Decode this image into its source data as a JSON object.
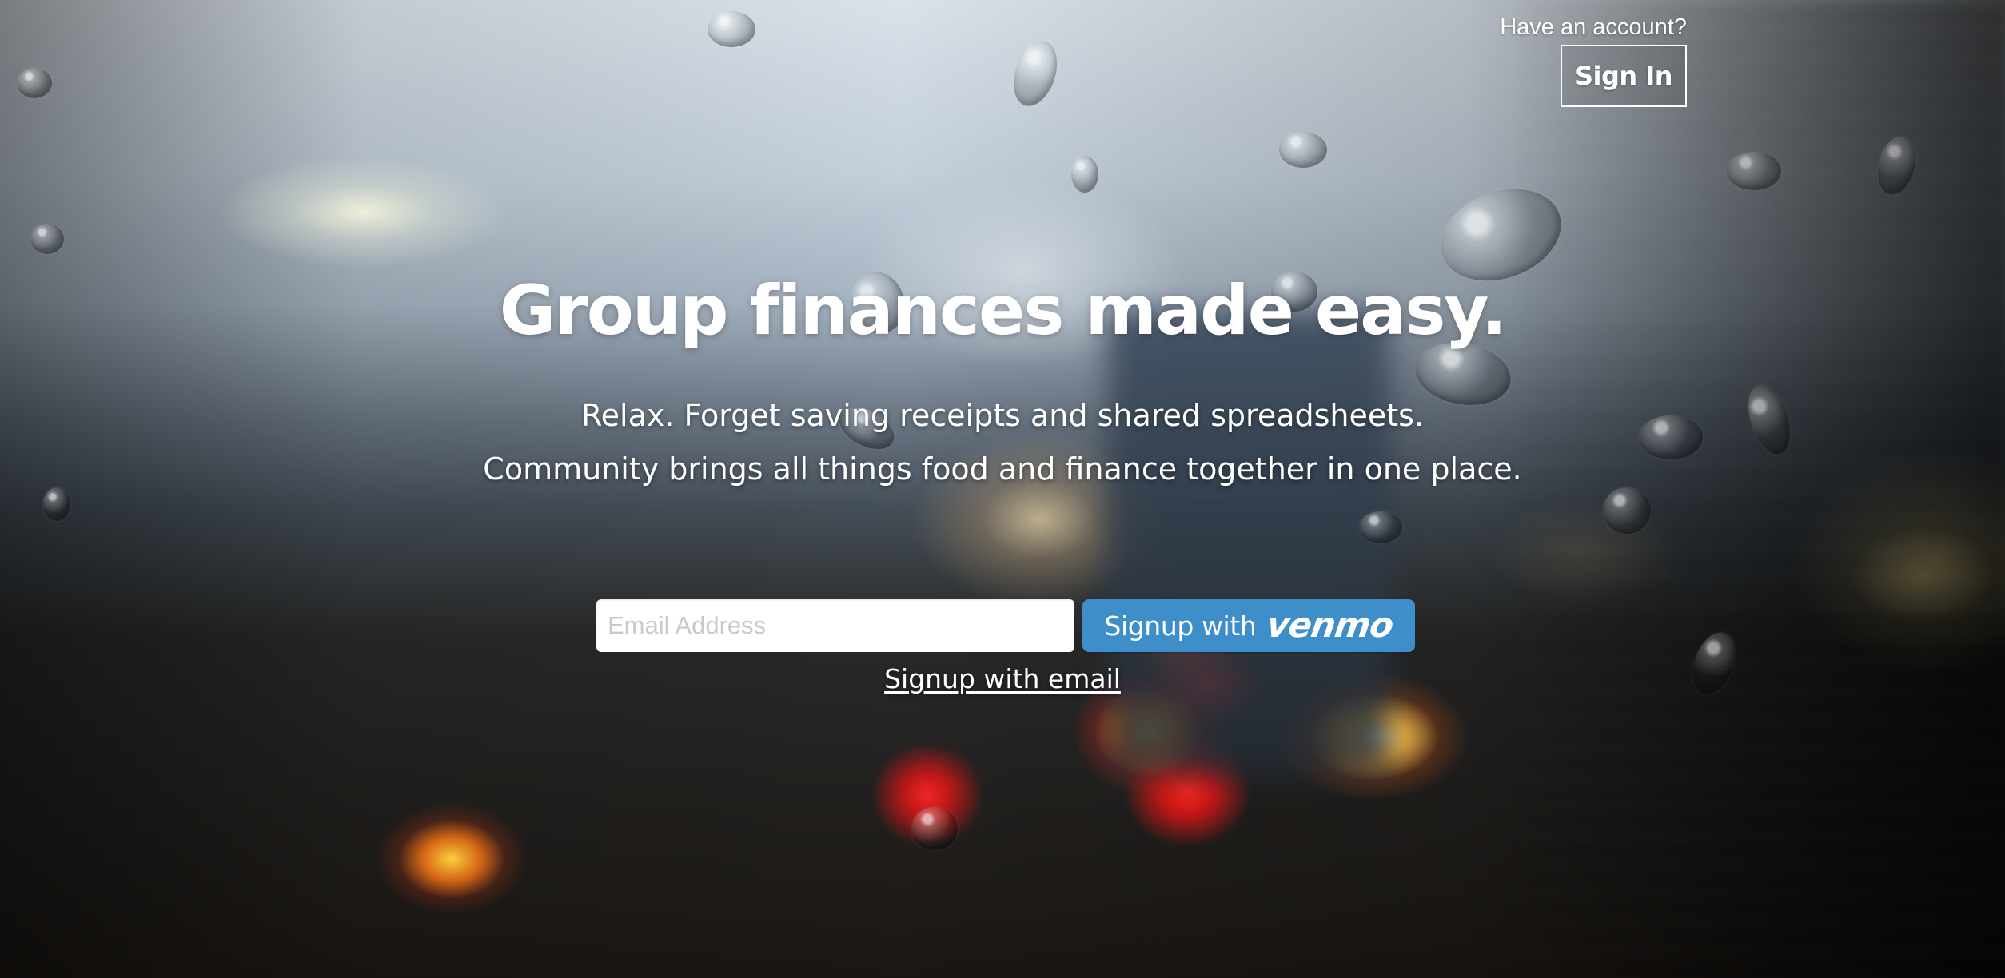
{
  "header": {
    "account_prompt": "Have an account?",
    "sign_in_label": "Sign In"
  },
  "hero": {
    "headline": "Group finances made easy.",
    "subtext_line_1": "Relax. Forget saving receipts and shared spreadsheets.",
    "subtext_line_2": "Community brings all things food and finance together in one place."
  },
  "signup": {
    "email_placeholder": "Email Address",
    "venmo_prefix": "Signup with",
    "venmo_wordmark": "venmo",
    "email_link": "Signup with email"
  },
  "colors": {
    "venmo_button": "#3e8ec9",
    "text": "#ffffff"
  }
}
